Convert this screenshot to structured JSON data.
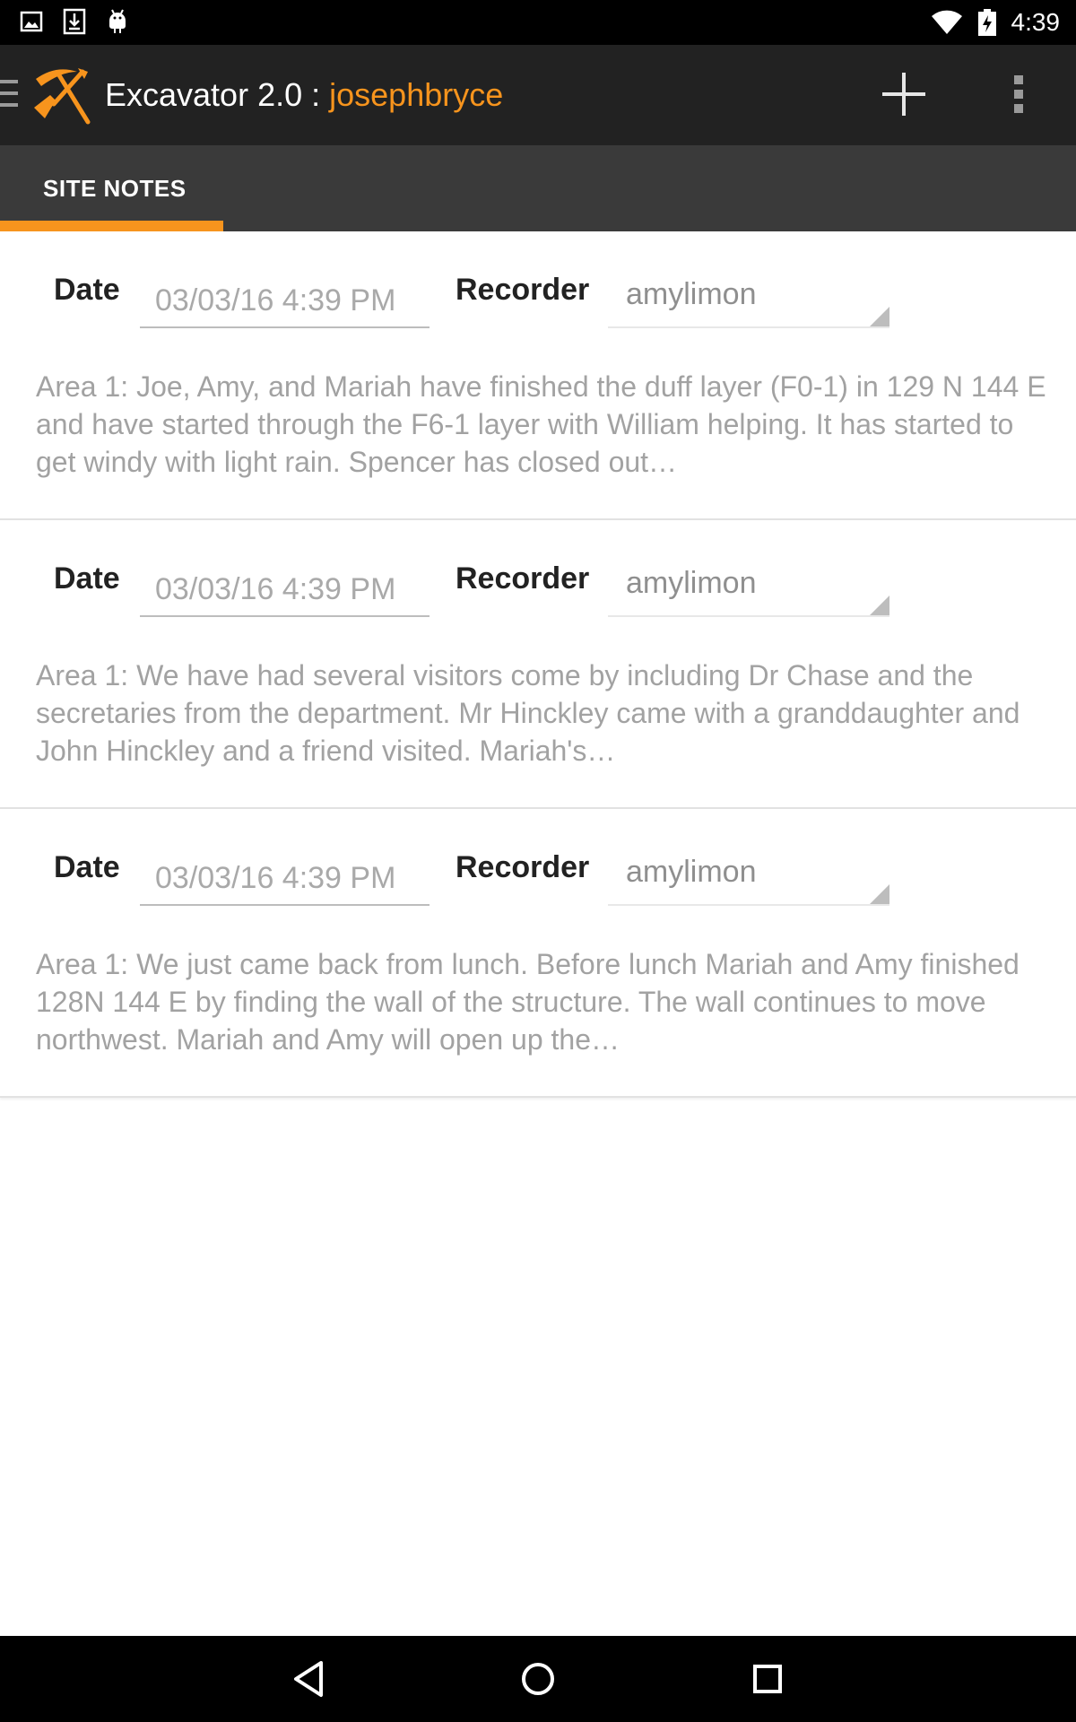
{
  "status_bar": {
    "time": "4:39",
    "left_icons": [
      "image-icon",
      "download-icon",
      "android-icon"
    ],
    "right_icons": [
      "wifi-icon",
      "battery-charging-icon"
    ]
  },
  "app_bar": {
    "title": "Excavator 2.0",
    "separator": " : ",
    "username": "josephbryce",
    "accent_color": "#f7941d",
    "icons": [
      "menu-icon",
      "excavator-logo-icon",
      "add-icon",
      "more-vert-icon"
    ]
  },
  "tabs": [
    {
      "label": "SITE NOTES",
      "selected": true
    }
  ],
  "notes": [
    {
      "date_label": "Date",
      "date_value": "03/03/16 4:39 PM",
      "recorder_label": "Recorder",
      "recorder_value": "amylimon",
      "text": "Area 1: Joe, Amy, and Mariah have finished the duff layer (F0-1) in 129 N 144 E and have started through the F6-1 layer with William helping. It has started to get windy with light rain. Spencer has closed out…"
    },
    {
      "date_label": "Date",
      "date_value": "03/03/16 4:39 PM",
      "recorder_label": "Recorder",
      "recorder_value": "amylimon",
      "text": "Area 1: We have had several visitors come by including Dr Chase and the secretaries from the department. Mr Hinckley came with a granddaughter and John Hinckley and a friend visited. Mariah's…"
    },
    {
      "date_label": "Date",
      "date_value": "03/03/16 4:39 PM",
      "recorder_label": "Recorder",
      "recorder_value": "amylimon",
      "text": "Area 1: We just came back from lunch. Before lunch Mariah and Amy finished 128N 144 E by finding the wall of the structure. The wall continues to move northwest. Mariah and Amy will open up the…"
    }
  ],
  "nav_bar": {
    "icons": [
      "back-icon",
      "home-icon",
      "recents-icon"
    ]
  }
}
